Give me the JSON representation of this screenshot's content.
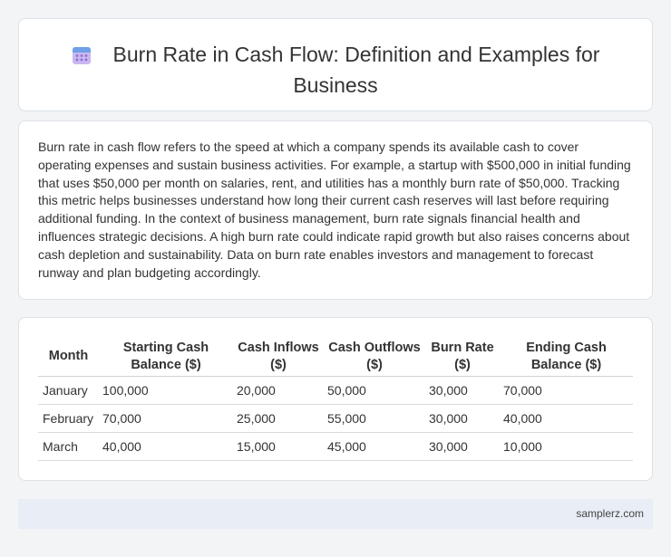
{
  "header": {
    "title": "Burn Rate in Cash Flow: Definition and Examples for Business",
    "icon": "calendar-icon"
  },
  "summary": {
    "text": "Burn rate in cash flow refers to the speed at which a company spends its available cash to cover operating expenses and sustain business activities. For example, a startup with $500,000 in initial funding that uses $50,000 per month on salaries, rent, and utilities has a monthly burn rate of $50,000. Tracking this metric helps businesses understand how long their current cash reserves will last before requiring additional funding. In the context of business management, burn rate signals financial health and influences strategic decisions. A high burn rate could indicate rapid growth but also raises concerns about cash depletion and sustainability. Data on burn rate enables investors and management to forecast runway and plan budgeting accordingly."
  },
  "table": {
    "columns": [
      "Month",
      "Starting Cash Balance ($)",
      "Cash Inflows ($)",
      "Cash Outflows ($)",
      "Burn Rate ($)",
      "Ending Cash Balance ($)"
    ],
    "rows": [
      [
        "January",
        "100,000",
        "20,000",
        "50,000",
        "30,000",
        "70,000"
      ],
      [
        "February",
        "70,000",
        "25,000",
        "55,000",
        "30,000",
        "40,000"
      ],
      [
        "March",
        "40,000",
        "15,000",
        "45,000",
        "30,000",
        "10,000"
      ]
    ]
  },
  "footer": {
    "text": "samplerz.com"
  },
  "colors": {
    "icon_top": "#6fa0e8",
    "icon_body": "#c9b7ef",
    "icon_dots": "#8a6fd6",
    "footer_bg": "#e8edf6"
  }
}
